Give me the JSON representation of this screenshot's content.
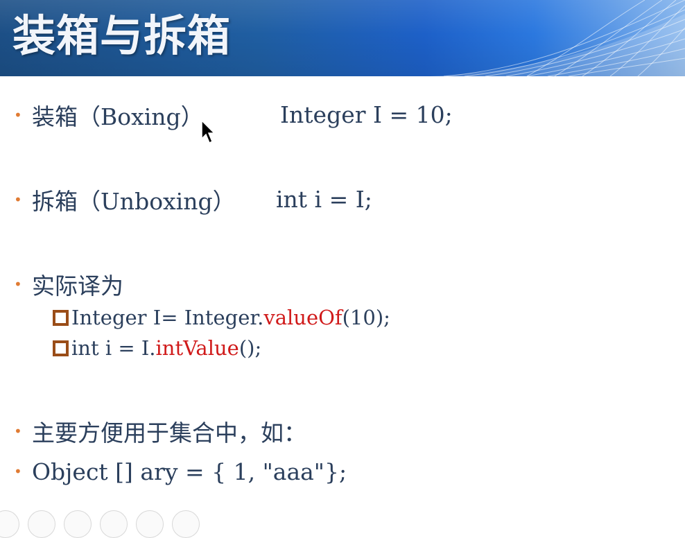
{
  "slide": {
    "title": "装箱与拆箱",
    "bullets": [
      {
        "label": "装箱（Boxing）",
        "code": "Integer I = 10;"
      },
      {
        "label": "拆箱（Unboxing）",
        "code": "int i = I;"
      },
      {
        "label": "实际译为"
      },
      {
        "label": "主要方便用于集合中，如："
      },
      {
        "label": "Object [] ary = { 1, \"aaa\"};"
      }
    ],
    "sub_items": [
      {
        "pre": "Integer I= Integer.",
        "method": "valueOf",
        "post": "(10);"
      },
      {
        "pre": "int i = I.",
        "method": "intValue",
        "post": "();"
      }
    ]
  },
  "colors": {
    "text": "#2b3f5c",
    "bullet": "#e07b33",
    "method": "#d01a1a",
    "checkbox": "#9a4d18",
    "banner_dark": "#1c4f86",
    "banner_light": "#84b4ec"
  },
  "icons": {
    "pointer": "mouse-pointer-icon",
    "bullet": "bullet-dot-icon",
    "sub_bullet": "square-bullet-icon"
  }
}
